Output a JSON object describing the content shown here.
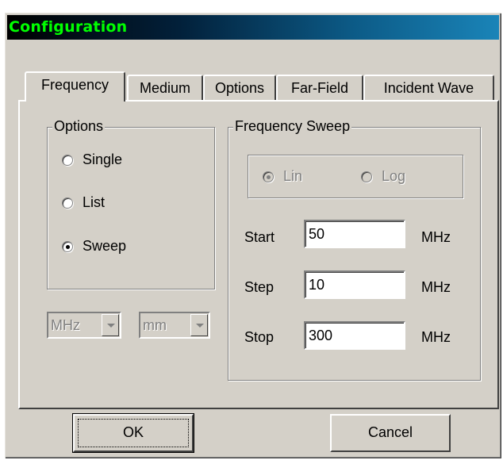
{
  "window": {
    "title": "Configuration"
  },
  "tabs": [
    {
      "label": "Frequency",
      "active": true
    },
    {
      "label": "Medium",
      "active": false
    },
    {
      "label": "Options",
      "active": false
    },
    {
      "label": "Far-Field",
      "active": false
    },
    {
      "label": "Incident Wave",
      "active": false
    }
  ],
  "options_group": {
    "label": "Options",
    "radios": [
      {
        "label": "Single",
        "checked": false
      },
      {
        "label": "List",
        "checked": false
      },
      {
        "label": "Sweep",
        "checked": true
      }
    ]
  },
  "units": {
    "frequency": {
      "value": "MHz"
    },
    "length": {
      "value": "mm"
    }
  },
  "sweep_group": {
    "label": "Frequency Sweep",
    "scale": [
      {
        "label": "Lin",
        "checked": true,
        "disabled": true
      },
      {
        "label": "Log",
        "checked": false,
        "disabled": true
      }
    ],
    "fields": [
      {
        "label": "Start",
        "value": "50",
        "unit": "MHz"
      },
      {
        "label": "Step",
        "value": "10",
        "unit": "MHz"
      },
      {
        "label": "Stop",
        "value": "300",
        "unit": "MHz"
      }
    ]
  },
  "buttons": {
    "ok": "OK",
    "cancel": "Cancel"
  }
}
